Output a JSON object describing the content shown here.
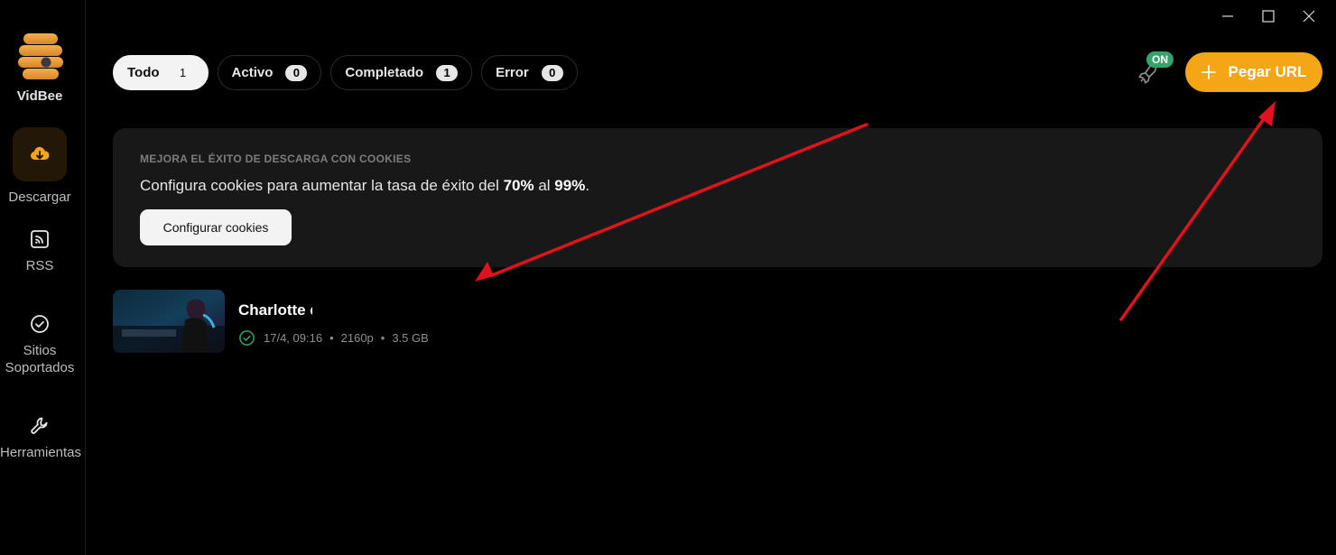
{
  "app": {
    "name": "VidBee"
  },
  "sidebar": {
    "items": [
      {
        "label": "Descargar",
        "icon": "download-cloud-icon",
        "active": true
      },
      {
        "label": "RSS",
        "icon": "rss-icon",
        "active": false
      },
      {
        "label": "Sitios Soportados",
        "icon": "check-circle-icon",
        "active": false
      },
      {
        "label": "Herramientas",
        "icon": "wrench-icon",
        "active": false
      }
    ]
  },
  "window_controls": {
    "minimize": "minimize-icon",
    "maximize": "maximize-icon",
    "close": "close-icon"
  },
  "tabs": [
    {
      "label": "Todo",
      "count": "1",
      "active": true
    },
    {
      "label": "Activo",
      "count": "0",
      "active": false
    },
    {
      "label": "Completado",
      "count": "1",
      "active": false
    },
    {
      "label": "Error",
      "count": "0",
      "active": false
    }
  ],
  "toolbar": {
    "boost_badge": "ON",
    "paste_label": "Pegar URL",
    "paste_icon": "plus"
  },
  "cookie_banner": {
    "title": "MEJORA EL ÉXITO DE DESCARGA CON COOKIES",
    "text_before": "Configura cookies para aumentar la tasa de éxito del ",
    "value_from": "70%",
    "text_middle": " al ",
    "value_to": "99%",
    "text_after": ".",
    "button_label": "Configurar cookies"
  },
  "downloads": [
    {
      "title": "Charlotte d",
      "date": "17/4, 09:16",
      "resolution": "2160p",
      "size": "3.5 GB",
      "status": "completed"
    }
  ],
  "colors": {
    "accent": "#f5a614",
    "success": "#36a36a",
    "annotation_arrow": "#e0121b"
  }
}
